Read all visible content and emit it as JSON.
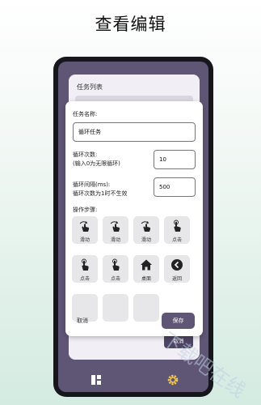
{
  "page_title": "查看编辑",
  "background_screen": {
    "title": "任务列表",
    "cancel_label": "取消"
  },
  "dialog": {
    "task_name_label": "任务名称:",
    "task_name_value": "循环任务",
    "loop_count_label_line1": "循环次数:",
    "loop_count_label_line2": "(输入0为无限循环)",
    "loop_count_value": "10",
    "loop_interval_label_line1": "循环间隔(ms):",
    "loop_interval_label_line2": "循环次数为1时不生效",
    "loop_interval_value": "500",
    "steps_label": "操作步骤:",
    "steps": [
      {
        "label": "滑动",
        "icon": "swipe-icon"
      },
      {
        "label": "滑动",
        "icon": "swipe-icon"
      },
      {
        "label": "滑动",
        "icon": "swipe-icon"
      },
      {
        "label": "点击",
        "icon": "tap-icon"
      },
      {
        "label": "点击",
        "icon": "tap-icon"
      },
      {
        "label": "点击",
        "icon": "tap-icon"
      },
      {
        "label": "桌面",
        "icon": "home-icon"
      },
      {
        "label": "返回",
        "icon": "back-icon"
      }
    ],
    "cancel_label": "取消",
    "save_label": "保存"
  },
  "bottom_nav": [
    "dashboard-icon",
    "settings-icon"
  ],
  "watermark": "下载吧在线",
  "colors": {
    "accent": "#5f5676",
    "phone_frame": "#18161d",
    "step_bg": "#e7e6e8"
  }
}
